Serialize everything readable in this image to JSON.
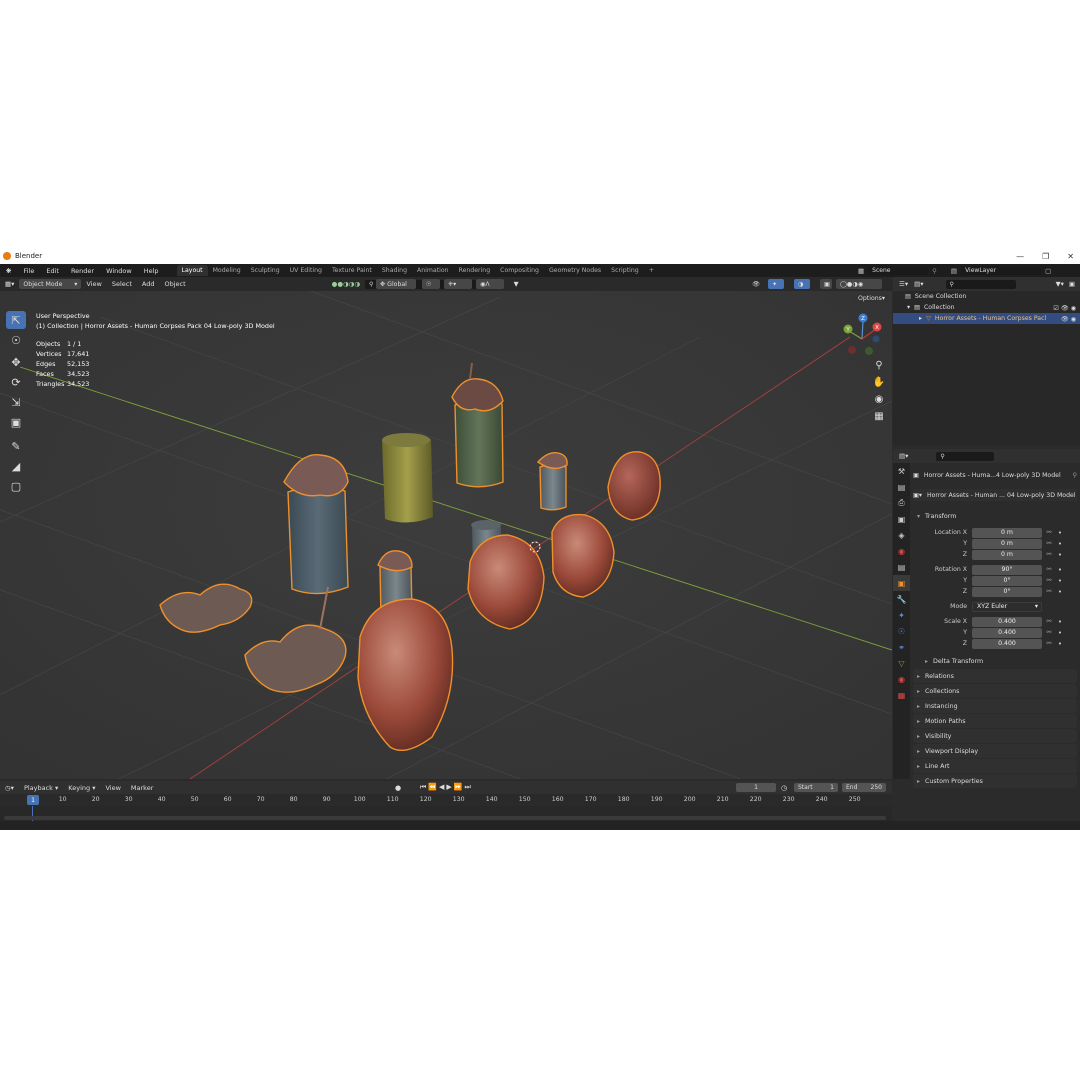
{
  "window": {
    "title": "Blender"
  },
  "menu": [
    "File",
    "Edit",
    "Render",
    "Window",
    "Help"
  ],
  "workspaces": [
    "Layout",
    "Modeling",
    "Sculpting",
    "UV Editing",
    "Texture Paint",
    "Shading",
    "Animation",
    "Rendering",
    "Compositing",
    "Geometry Nodes",
    "Scripting"
  ],
  "scene": {
    "name": "Scene",
    "view_layer": "ViewLayer"
  },
  "viewport": {
    "mode": "Object Mode",
    "menus": [
      "View",
      "Select",
      "Add",
      "Object"
    ],
    "orientation": "Global",
    "options_label": "Options",
    "overlay_title": "User Perspective",
    "overlay_collection": "(1) Collection | Horror Assets - Human Corpses Pack 04 Low-poly 3D Model",
    "stats": [
      {
        "label": "Objects",
        "value": "1 / 1"
      },
      {
        "label": "Vertices",
        "value": "17,641"
      },
      {
        "label": "Edges",
        "value": "52,153"
      },
      {
        "label": "Faces",
        "value": "34,523"
      },
      {
        "label": "Triangles",
        "value": "34,523"
      }
    ],
    "gizmo_axes": {
      "x": "X",
      "y": "Y",
      "z": "Z"
    }
  },
  "outliner": {
    "scene_collection": "Scene Collection",
    "collection": "Collection",
    "object": "Horror Assets - Human Corpses Pacl"
  },
  "properties": {
    "object_name": "Horror Assets - Huma...4 Low-poly 3D Model",
    "data_name": "Horror Assets - Human ... 04 Low-poly 3D Model",
    "transform_title": "Transform",
    "location": {
      "label_x": "Location X",
      "label_y": "Y",
      "label_z": "Z",
      "x": "0 m",
      "y": "0 m",
      "z": "0 m"
    },
    "rotation": {
      "label_x": "Rotation X",
      "label_y": "Y",
      "label_z": "Z",
      "x": "90°",
      "y": "0°",
      "z": "0°"
    },
    "mode": {
      "label": "Mode",
      "value": "XYZ Euler"
    },
    "scale": {
      "label_x": "Scale X",
      "label_y": "Y",
      "label_z": "Z",
      "x": "0.400",
      "y": "0.400",
      "z": "0.400"
    },
    "delta_transform": "Delta Transform",
    "panels": [
      "Relations",
      "Collections",
      "Instancing",
      "Motion Paths",
      "Visibility",
      "Viewport Display",
      "Line Art",
      "Custom Properties"
    ]
  },
  "timeline": {
    "menus": [
      "Playback",
      "Keying",
      "View",
      "Marker"
    ],
    "current_frame": "1",
    "start_label": "Start",
    "start": "1",
    "end_label": "End",
    "end": "250",
    "ticks": [
      "1",
      "10",
      "20",
      "30",
      "40",
      "50",
      "60",
      "70",
      "80",
      "90",
      "100",
      "110",
      "120",
      "130",
      "140",
      "150",
      "160",
      "170",
      "180",
      "190",
      "200",
      "210",
      "220",
      "230",
      "240",
      "250"
    ]
  },
  "colors": {
    "accent": "#4772b3",
    "selection_outline": "#f0902a",
    "header": "#1d1d1d"
  }
}
